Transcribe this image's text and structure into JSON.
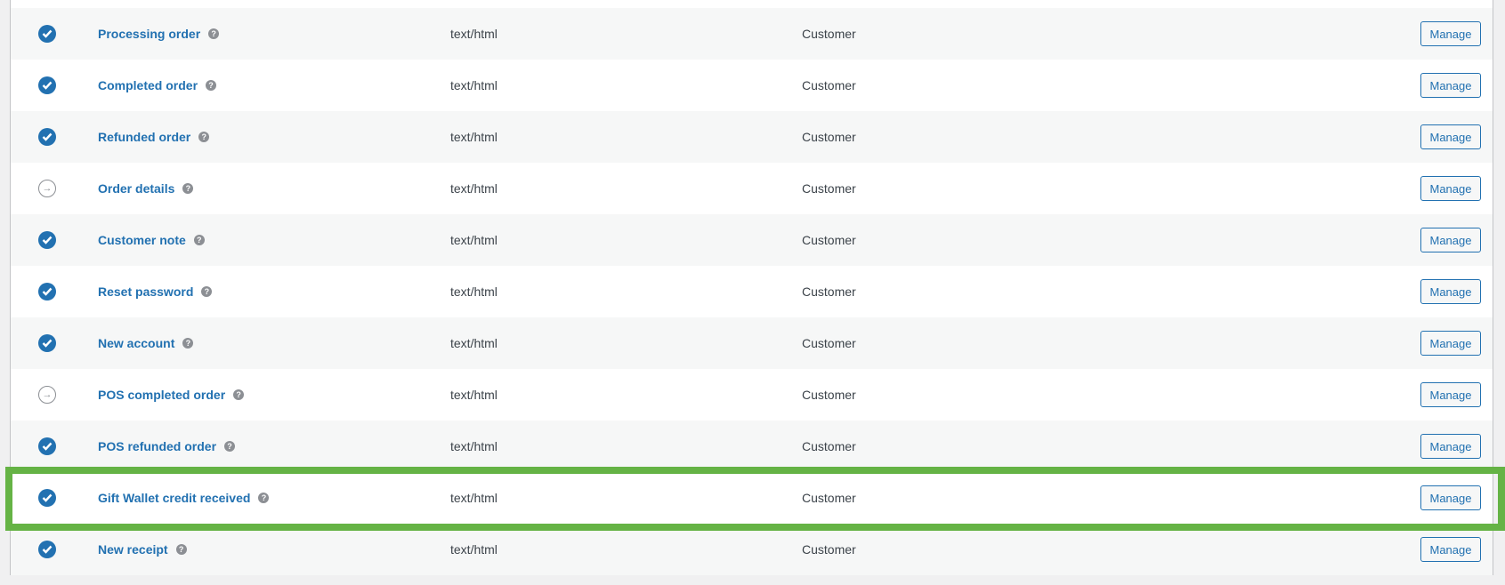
{
  "rows": [
    {
      "name": "Processing order",
      "type": "text/html",
      "recipient": "Customer",
      "enabled": true,
      "action": "Manage"
    },
    {
      "name": "Completed order",
      "type": "text/html",
      "recipient": "Customer",
      "enabled": true,
      "action": "Manage"
    },
    {
      "name": "Refunded order",
      "type": "text/html",
      "recipient": "Customer",
      "enabled": true,
      "action": "Manage"
    },
    {
      "name": "Order details",
      "type": "text/html",
      "recipient": "Customer",
      "enabled": false,
      "action": "Manage"
    },
    {
      "name": "Customer note",
      "type": "text/html",
      "recipient": "Customer",
      "enabled": true,
      "action": "Manage"
    },
    {
      "name": "Reset password",
      "type": "text/html",
      "recipient": "Customer",
      "enabled": true,
      "action": "Manage"
    },
    {
      "name": "New account",
      "type": "text/html",
      "recipient": "Customer",
      "enabled": true,
      "action": "Manage"
    },
    {
      "name": "POS completed order",
      "type": "text/html",
      "recipient": "Customer",
      "enabled": false,
      "action": "Manage"
    },
    {
      "name": "POS refunded order",
      "type": "text/html",
      "recipient": "Customer",
      "enabled": true,
      "action": "Manage"
    },
    {
      "name": "Gift Wallet credit received",
      "type": "text/html",
      "recipient": "Customer",
      "enabled": true,
      "action": "Manage",
      "highlighted": true
    },
    {
      "name": "New receipt",
      "type": "text/html",
      "recipient": "Customer",
      "enabled": true,
      "action": "Manage"
    }
  ],
  "help_glyph": "?",
  "highlight_color": "#65b345",
  "accent_color": "#2271b1"
}
